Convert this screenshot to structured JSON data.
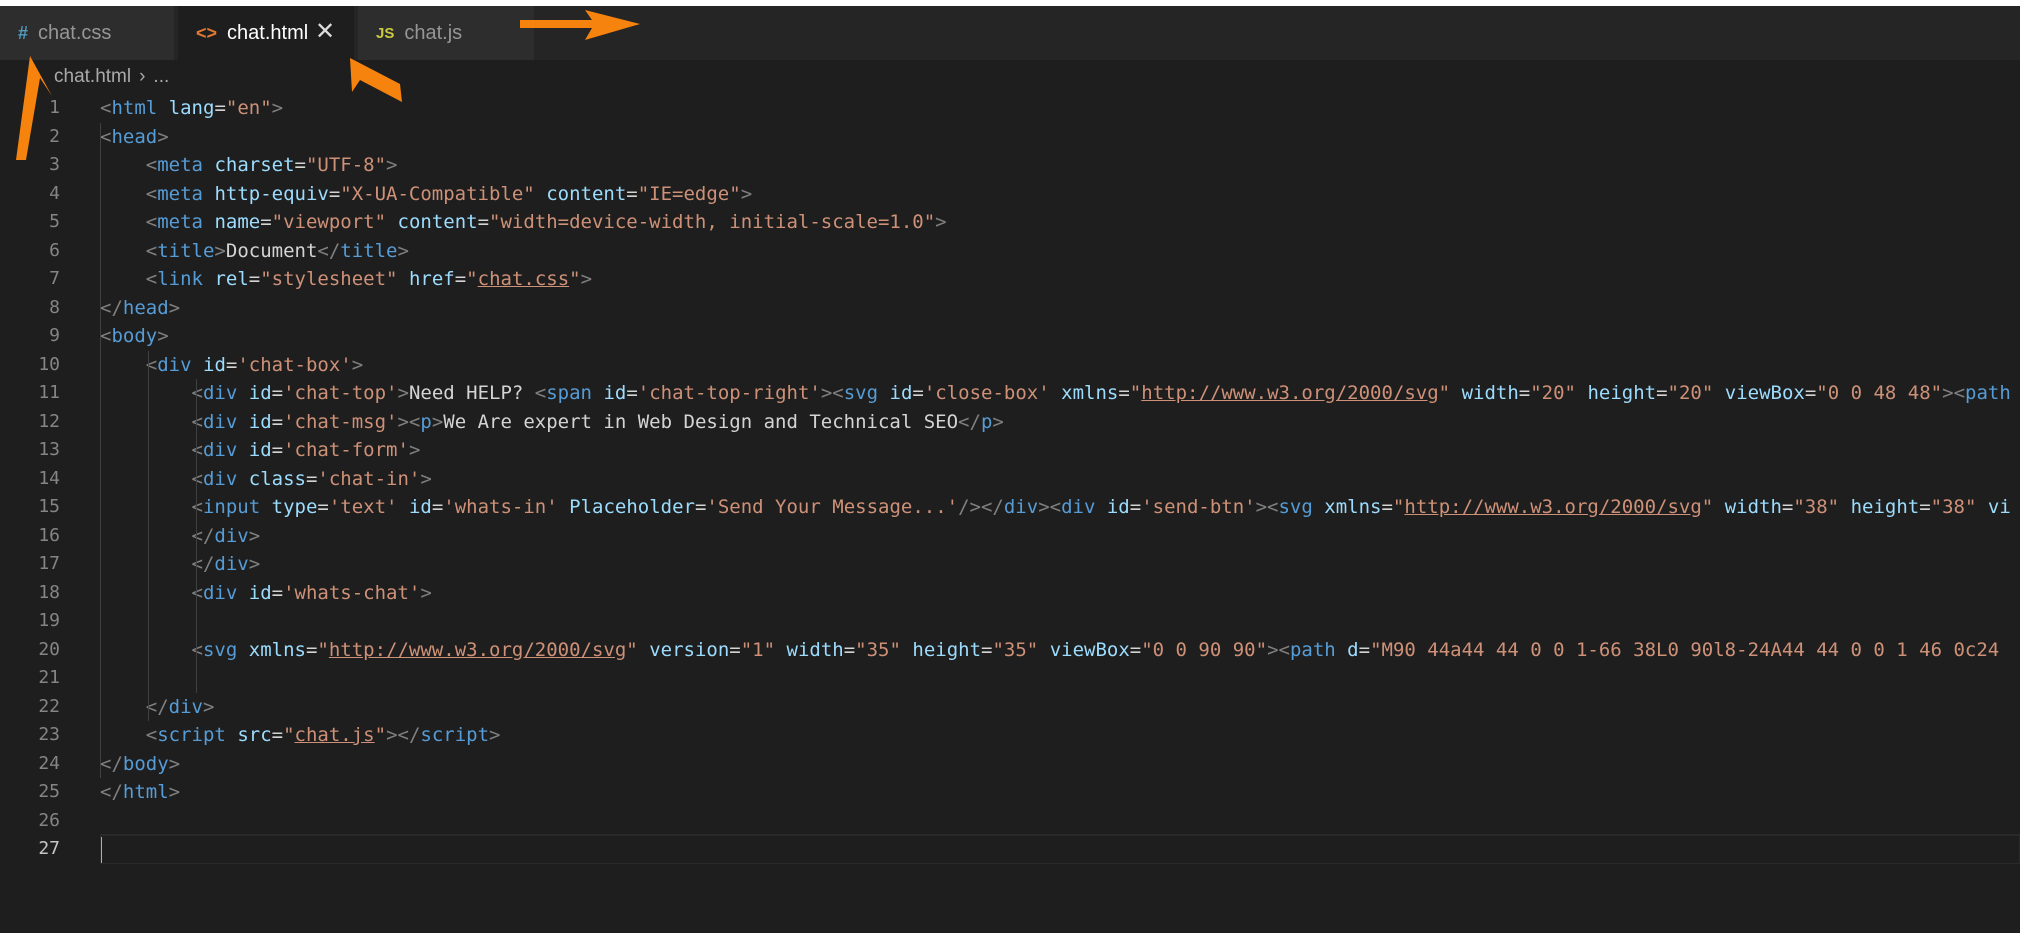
{
  "tabs": [
    {
      "icon": "#",
      "icon_color": "#519aba",
      "label": "chat.css",
      "active": false
    },
    {
      "icon": "<>",
      "icon_color": "#e37933",
      "label": "chat.html",
      "active": true,
      "close": "✕"
    },
    {
      "icon": "JS",
      "icon_color": "#cbcb41",
      "label": "chat.js",
      "active": false
    }
  ],
  "breadcrumb": {
    "file": "chat.html",
    "separator": "›",
    "rest": "..."
  },
  "editor": {
    "current_line": 27,
    "line_numbers": [
      "1",
      "2",
      "3",
      "4",
      "5",
      "6",
      "7",
      "8",
      "9",
      "10",
      "11",
      "12",
      "13",
      "14",
      "15",
      "16",
      "17",
      "18",
      "19",
      "20",
      "21",
      "22",
      "23",
      "24",
      "25",
      "26",
      "27"
    ],
    "lines": [
      [
        [
          "t",
          "<"
        ],
        [
          "n",
          "html"
        ],
        [
          "x",
          " "
        ],
        [
          "a",
          "lang"
        ],
        [
          "x",
          "="
        ],
        [
          "s",
          "\"en\""
        ],
        [
          "t",
          ">"
        ]
      ],
      [
        [
          "t",
          "<"
        ],
        [
          "n",
          "head"
        ],
        [
          "t",
          ">"
        ]
      ],
      [
        [
          "x",
          "    "
        ],
        [
          "t",
          "<"
        ],
        [
          "n",
          "meta"
        ],
        [
          "x",
          " "
        ],
        [
          "a",
          "charset"
        ],
        [
          "x",
          "="
        ],
        [
          "s",
          "\"UTF-8\""
        ],
        [
          "t",
          ">"
        ]
      ],
      [
        [
          "x",
          "    "
        ],
        [
          "t",
          "<"
        ],
        [
          "n",
          "meta"
        ],
        [
          "x",
          " "
        ],
        [
          "a",
          "http-equiv"
        ],
        [
          "x",
          "="
        ],
        [
          "s",
          "\"X-UA-Compatible\""
        ],
        [
          "x",
          " "
        ],
        [
          "a",
          "content"
        ],
        [
          "x",
          "="
        ],
        [
          "s",
          "\"IE=edge\""
        ],
        [
          "t",
          ">"
        ]
      ],
      [
        [
          "x",
          "    "
        ],
        [
          "t",
          "<"
        ],
        [
          "n",
          "meta"
        ],
        [
          "x",
          " "
        ],
        [
          "a",
          "name"
        ],
        [
          "x",
          "="
        ],
        [
          "s",
          "\"viewport\""
        ],
        [
          "x",
          " "
        ],
        [
          "a",
          "content"
        ],
        [
          "x",
          "="
        ],
        [
          "s",
          "\"width=device-width, initial-scale=1.0\""
        ],
        [
          "t",
          ">"
        ]
      ],
      [
        [
          "x",
          "    "
        ],
        [
          "t",
          "<"
        ],
        [
          "n",
          "title"
        ],
        [
          "t",
          ">"
        ],
        [
          "x",
          "Document"
        ],
        [
          "t",
          "</"
        ],
        [
          "n",
          "title"
        ],
        [
          "t",
          ">"
        ]
      ],
      [
        [
          "x",
          "    "
        ],
        [
          "t",
          "<"
        ],
        [
          "n",
          "link"
        ],
        [
          "x",
          " "
        ],
        [
          "a",
          "rel"
        ],
        [
          "x",
          "="
        ],
        [
          "s",
          "\"stylesheet\""
        ],
        [
          "x",
          " "
        ],
        [
          "a",
          "href"
        ],
        [
          "x",
          "="
        ],
        [
          "s",
          "\""
        ],
        [
          "su",
          "chat.css"
        ],
        [
          "s",
          "\""
        ],
        [
          "t",
          ">"
        ]
      ],
      [
        [
          "t",
          "</"
        ],
        [
          "n",
          "head"
        ],
        [
          "t",
          ">"
        ]
      ],
      [
        [
          "t",
          "<"
        ],
        [
          "n",
          "body"
        ],
        [
          "t",
          ">"
        ]
      ],
      [
        [
          "x",
          "    "
        ],
        [
          "t",
          "<"
        ],
        [
          "n",
          "div"
        ],
        [
          "x",
          " "
        ],
        [
          "a",
          "id"
        ],
        [
          "x",
          "="
        ],
        [
          "s",
          "'chat-box'"
        ],
        [
          "t",
          ">"
        ]
      ],
      [
        [
          "x",
          "        "
        ],
        [
          "t",
          "<"
        ],
        [
          "n",
          "div"
        ],
        [
          "x",
          " "
        ],
        [
          "a",
          "id"
        ],
        [
          "x",
          "="
        ],
        [
          "s",
          "'chat-top'"
        ],
        [
          "t",
          ">"
        ],
        [
          "x",
          "Need HELP? "
        ],
        [
          "t",
          "<"
        ],
        [
          "n",
          "span"
        ],
        [
          "x",
          " "
        ],
        [
          "a",
          "id"
        ],
        [
          "x",
          "="
        ],
        [
          "s",
          "'chat-top-right'"
        ],
        [
          "t",
          "><"
        ],
        [
          "n",
          "svg"
        ],
        [
          "x",
          " "
        ],
        [
          "a",
          "id"
        ],
        [
          "x",
          "="
        ],
        [
          "s",
          "'close-box'"
        ],
        [
          "x",
          " "
        ],
        [
          "a",
          "xmlns"
        ],
        [
          "x",
          "="
        ],
        [
          "s",
          "\""
        ],
        [
          "su",
          "http://www.w3.org/2000/svg"
        ],
        [
          "s",
          "\""
        ],
        [
          "x",
          " "
        ],
        [
          "a",
          "width"
        ],
        [
          "x",
          "="
        ],
        [
          "s",
          "\"20\""
        ],
        [
          "x",
          " "
        ],
        [
          "a",
          "height"
        ],
        [
          "x",
          "="
        ],
        [
          "s",
          "\"20\""
        ],
        [
          "x",
          " "
        ],
        [
          "a",
          "viewBox"
        ],
        [
          "x",
          "="
        ],
        [
          "s",
          "\"0 0 48 48\""
        ],
        [
          "t",
          "><"
        ],
        [
          "n",
          "path"
        ]
      ],
      [
        [
          "x",
          "        "
        ],
        [
          "t",
          "<"
        ],
        [
          "n",
          "div"
        ],
        [
          "x",
          " "
        ],
        [
          "a",
          "id"
        ],
        [
          "x",
          "="
        ],
        [
          "s",
          "'chat-msg'"
        ],
        [
          "t",
          "><"
        ],
        [
          "n",
          "p"
        ],
        [
          "t",
          ">"
        ],
        [
          "x",
          "We Are expert in Web Design and Technical SEO"
        ],
        [
          "t",
          "</"
        ],
        [
          "n",
          "p"
        ],
        [
          "t",
          ">"
        ]
      ],
      [
        [
          "x",
          "        "
        ],
        [
          "t",
          "<"
        ],
        [
          "n",
          "div"
        ],
        [
          "x",
          " "
        ],
        [
          "a",
          "id"
        ],
        [
          "x",
          "="
        ],
        [
          "s",
          "'chat-form'"
        ],
        [
          "t",
          ">"
        ]
      ],
      [
        [
          "x",
          "        "
        ],
        [
          "t",
          "<"
        ],
        [
          "n",
          "div"
        ],
        [
          "x",
          " "
        ],
        [
          "a",
          "class"
        ],
        [
          "x",
          "="
        ],
        [
          "s",
          "'chat-in'"
        ],
        [
          "t",
          ">"
        ]
      ],
      [
        [
          "x",
          "        "
        ],
        [
          "t",
          "<"
        ],
        [
          "n",
          "input"
        ],
        [
          "x",
          " "
        ],
        [
          "a",
          "type"
        ],
        [
          "x",
          "="
        ],
        [
          "s",
          "'text'"
        ],
        [
          "x",
          " "
        ],
        [
          "a",
          "id"
        ],
        [
          "x",
          "="
        ],
        [
          "s",
          "'whats-in'"
        ],
        [
          "x",
          " "
        ],
        [
          "a",
          "Placeholder"
        ],
        [
          "x",
          "="
        ],
        [
          "s",
          "'Send Your Message...'"
        ],
        [
          "t",
          "/></"
        ],
        [
          "n",
          "div"
        ],
        [
          "t",
          "><"
        ],
        [
          "n",
          "div"
        ],
        [
          "x",
          " "
        ],
        [
          "a",
          "id"
        ],
        [
          "x",
          "="
        ],
        [
          "s",
          "'send-btn'"
        ],
        [
          "t",
          "><"
        ],
        [
          "n",
          "svg"
        ],
        [
          "x",
          " "
        ],
        [
          "a",
          "xmlns"
        ],
        [
          "x",
          "="
        ],
        [
          "s",
          "\""
        ],
        [
          "su",
          "http://www.w3.org/2000/svg"
        ],
        [
          "s",
          "\""
        ],
        [
          "x",
          " "
        ],
        [
          "a",
          "width"
        ],
        [
          "x",
          "="
        ],
        [
          "s",
          "\"38\""
        ],
        [
          "x",
          " "
        ],
        [
          "a",
          "height"
        ],
        [
          "x",
          "="
        ],
        [
          "s",
          "\"38\""
        ],
        [
          "x",
          " "
        ],
        [
          "a",
          "vi"
        ]
      ],
      [
        [
          "x",
          "        "
        ],
        [
          "t",
          "</"
        ],
        [
          "n",
          "div"
        ],
        [
          "t",
          ">"
        ]
      ],
      [
        [
          "x",
          "        "
        ],
        [
          "t",
          "</"
        ],
        [
          "n",
          "div"
        ],
        [
          "t",
          ">"
        ]
      ],
      [
        [
          "x",
          "        "
        ],
        [
          "t",
          "<"
        ],
        [
          "n",
          "div"
        ],
        [
          "x",
          " "
        ],
        [
          "a",
          "id"
        ],
        [
          "x",
          "="
        ],
        [
          "s",
          "'whats-chat'"
        ],
        [
          "t",
          ">"
        ]
      ],
      [],
      [
        [
          "x",
          "        "
        ],
        [
          "t",
          "<"
        ],
        [
          "n",
          "svg"
        ],
        [
          "x",
          " "
        ],
        [
          "a",
          "xmlns"
        ],
        [
          "x",
          "="
        ],
        [
          "s",
          "\""
        ],
        [
          "su",
          "http://www.w3.org/2000/svg"
        ],
        [
          "s",
          "\""
        ],
        [
          "x",
          " "
        ],
        [
          "a",
          "version"
        ],
        [
          "x",
          "="
        ],
        [
          "s",
          "\"1\""
        ],
        [
          "x",
          " "
        ],
        [
          "a",
          "width"
        ],
        [
          "x",
          "="
        ],
        [
          "s",
          "\"35\""
        ],
        [
          "x",
          " "
        ],
        [
          "a",
          "height"
        ],
        [
          "x",
          "="
        ],
        [
          "s",
          "\"35\""
        ],
        [
          "x",
          " "
        ],
        [
          "a",
          "viewBox"
        ],
        [
          "x",
          "="
        ],
        [
          "s",
          "\"0 0 90 90\""
        ],
        [
          "t",
          "><"
        ],
        [
          "n",
          "path"
        ],
        [
          "x",
          " "
        ],
        [
          "a",
          "d"
        ],
        [
          "x",
          "="
        ],
        [
          "s",
          "\"M90 44a44 44 0 0 1-66 38L0 90l8-24A44 44 0 0 1 46 0c24"
        ]
      ],
      [],
      [
        [
          "x",
          "    "
        ],
        [
          "t",
          "</"
        ],
        [
          "n",
          "div"
        ],
        [
          "t",
          ">"
        ]
      ],
      [
        [
          "x",
          "    "
        ],
        [
          "t",
          "<"
        ],
        [
          "n",
          "script"
        ],
        [
          "x",
          " "
        ],
        [
          "a",
          "src"
        ],
        [
          "x",
          "="
        ],
        [
          "s",
          "\""
        ],
        [
          "su",
          "chat.js"
        ],
        [
          "s",
          "\""
        ],
        [
          "t",
          "></"
        ],
        [
          "n",
          "script"
        ],
        [
          "t",
          ">"
        ]
      ],
      [
        [
          "t",
          "</"
        ],
        [
          "n",
          "body"
        ],
        [
          "t",
          ">"
        ]
      ],
      [
        [
          "t",
          "</"
        ],
        [
          "n",
          "html"
        ],
        [
          "t",
          ">"
        ]
      ],
      [],
      []
    ]
  },
  "annotation_color": "#f7830f"
}
